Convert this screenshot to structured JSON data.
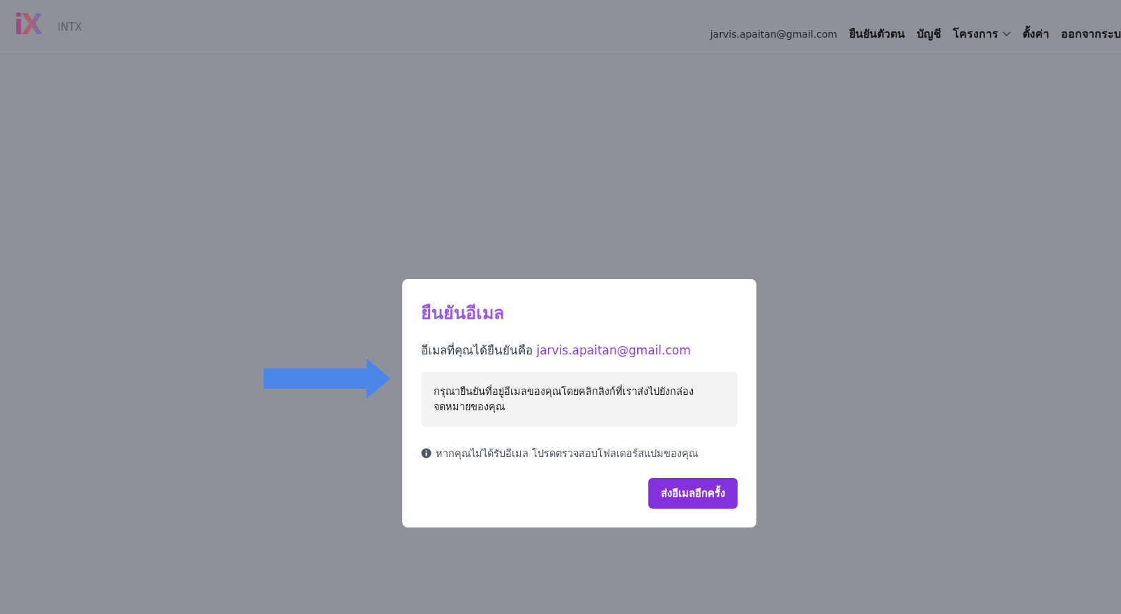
{
  "header": {
    "logo": "iX",
    "brand": "INTX",
    "email": "jarvis.apaitan@gmail.com",
    "nav": [
      {
        "label": "ยืนยันตัวตน",
        "kind": "link"
      },
      {
        "label": "บัญชี",
        "kind": "link"
      },
      {
        "label": "โครงการ",
        "kind": "dropdown"
      },
      {
        "label": "ตั้งค่า",
        "kind": "link"
      },
      {
        "label": "ออกจากระบ",
        "kind": "link"
      }
    ]
  },
  "modal": {
    "title": "ยืนยันอีเมล",
    "email_label": "อีเมลที่คุณได้ยืนยันคือ",
    "email": "jarvis.apaitan@gmail.com",
    "notice": "กรุณายืนยันที่อยู่อีเมลของคุณโดยคลิกลิงก์ที่เราส่งไปยังกล่องจดหมายของคุณ",
    "hint": "หากคุณไม่ได้รับอีเมล โปรดตรวจสอบโฟลเดอร์สแปมของคุณ",
    "button": "ส่งอีเมลอีกครั้ง"
  }
}
